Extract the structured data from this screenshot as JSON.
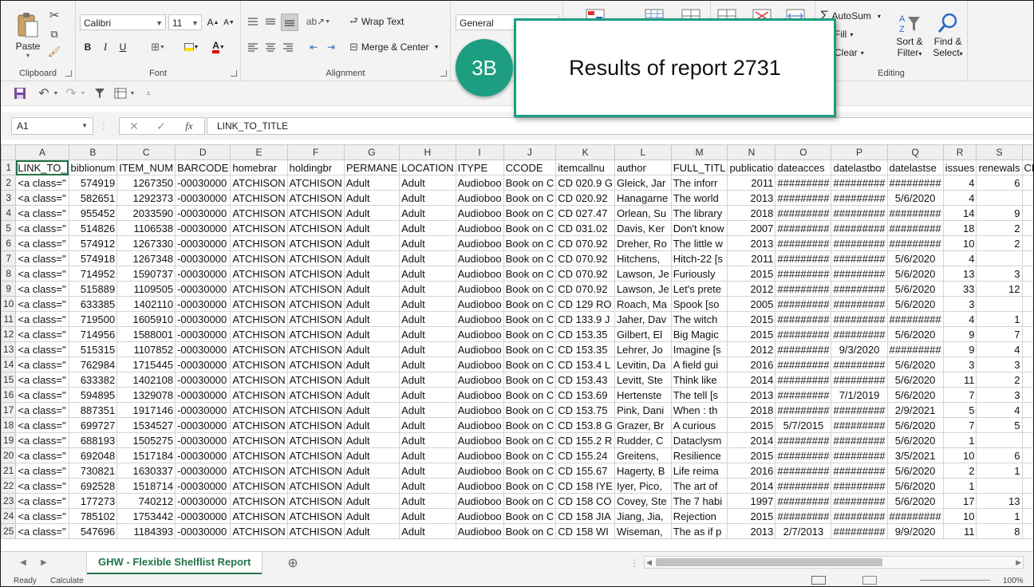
{
  "ribbon": {
    "clipboard": {
      "label": "Clipboard",
      "paste": "Paste"
    },
    "font": {
      "label": "Font",
      "name": "Calibri",
      "size": "11",
      "bold": "B",
      "italic": "I",
      "underline": "U"
    },
    "alignment": {
      "label": "Alignment",
      "wrap_text": "Wrap Text",
      "merge_center": "Merge & Center"
    },
    "number": {
      "format": "General"
    },
    "editing": {
      "label": "Editing",
      "autosum": "AutoSum",
      "fill": "Fill",
      "clear": "Clear",
      "sort_filter_1": "Sort &",
      "sort_filter_2": "Filter",
      "find_select_1": "Find &",
      "find_select_2": "Select"
    }
  },
  "formula_bar": {
    "name_box": "A1",
    "fx": "fx",
    "formula": "LINK_TO_TITLE"
  },
  "callout": {
    "badge": "3B",
    "text": "Results of report 2731"
  },
  "grid": {
    "columns": [
      "A",
      "B",
      "C",
      "D",
      "E",
      "F",
      "G",
      "H",
      "I",
      "J",
      "K",
      "L",
      "M",
      "N",
      "O",
      "P",
      "Q",
      "R",
      "S",
      "T"
    ],
    "rows": [
      [
        "LINK_TO_",
        "biblionum",
        "ITEM_NUM",
        "BARCODE",
        "homebrar",
        "holdingbr",
        "PERMANE",
        "LOCATION",
        "ITYPE",
        "CCODE",
        "itemcallnu",
        "author",
        "FULL_TITL",
        "publicatio",
        "dateacces",
        "datelastbo",
        "datelastse",
        "issues",
        "renewals",
        "CHEC"
      ],
      [
        "<a class=\"",
        "574919",
        "1267350",
        "-00030000",
        "ATCHISON",
        "ATCHISON",
        "Adult",
        "Adult",
        "Audioboo",
        "Book on C",
        "CD 020.9 G",
        "Gleick, Jar",
        "The inforr",
        "2011",
        "#########",
        "#########",
        "#########",
        "4",
        "6",
        ""
      ],
      [
        "<a class=\"",
        "582651",
        "1292373",
        "-00030000",
        "ATCHISON",
        "ATCHISON",
        "Adult",
        "Adult",
        "Audioboo",
        "Book on C",
        "CD 020.92",
        "Hanagarne",
        "The world",
        "2013",
        "#########",
        "#########",
        "5/6/2020",
        "4",
        "",
        ""
      ],
      [
        "<a class=\"",
        "955452",
        "2033590",
        "-00030000",
        "ATCHISON",
        "ATCHISON",
        "Adult",
        "Adult",
        "Audioboo",
        "Book on C",
        "CD 027.47",
        "Orlean, Su",
        "The library",
        "2018",
        "#########",
        "#########",
        "#########",
        "14",
        "9",
        ""
      ],
      [
        "<a class=\"",
        "514826",
        "1106538",
        "-00030000",
        "ATCHISON",
        "ATCHISON",
        "Adult",
        "Adult",
        "Audioboo",
        "Book on C",
        "CD 031.02",
        "Davis, Ker",
        "Don't know",
        "2007",
        "#########",
        "#########",
        "#########",
        "18",
        "2",
        ""
      ],
      [
        "<a class=\"",
        "574912",
        "1267330",
        "-00030000",
        "ATCHISON",
        "ATCHISON",
        "Adult",
        "Adult",
        "Audioboo",
        "Book on C",
        "CD 070.92",
        "Dreher, Ro",
        "The little w",
        "2013",
        "#########",
        "#########",
        "#########",
        "10",
        "2",
        ""
      ],
      [
        "<a class=\"",
        "574918",
        "1267348",
        "-00030000",
        "ATCHISON",
        "ATCHISON",
        "Adult",
        "Adult",
        "Audioboo",
        "Book on C",
        "CD 070.92",
        "Hitchens,",
        "Hitch-22 [s",
        "2011",
        "#########",
        "#########",
        "5/6/2020",
        "4",
        "",
        ""
      ],
      [
        "<a class=\"",
        "714952",
        "1590737",
        "-00030000",
        "ATCHISON",
        "ATCHISON",
        "Adult",
        "Adult",
        "Audioboo",
        "Book on C",
        "CD 070.92",
        "Lawson, Je",
        "Furiously",
        "2015",
        "#########",
        "#########",
        "5/6/2020",
        "13",
        "3",
        ""
      ],
      [
        "<a class=\"",
        "515889",
        "1109505",
        "-00030000",
        "ATCHISON",
        "ATCHISON",
        "Adult",
        "Adult",
        "Audioboo",
        "Book on C",
        "CD 070.92",
        "Lawson, Je",
        "Let's prete",
        "2012",
        "#########",
        "#########",
        "5/6/2020",
        "33",
        "12",
        ""
      ],
      [
        "<a class=\"",
        "633385",
        "1402110",
        "-00030000",
        "ATCHISON",
        "ATCHISON",
        "Adult",
        "Adult",
        "Audioboo",
        "Book on C",
        "CD 129 RO",
        "Roach, Ma",
        "Spook [so",
        "2005",
        "#########",
        "#########",
        "5/6/2020",
        "3",
        "",
        ""
      ],
      [
        "<a class=\"",
        "719500",
        "1605910",
        "-00030000",
        "ATCHISON",
        "ATCHISON",
        "Adult",
        "Adult",
        "Audioboo",
        "Book on C",
        "CD 133.9 J",
        "Jaher, Dav",
        "The witch",
        "2015",
        "#########",
        "#########",
        "#########",
        "4",
        "1",
        ""
      ],
      [
        "<a class=\"",
        "714956",
        "1588001",
        "-00030000",
        "ATCHISON",
        "ATCHISON",
        "Adult",
        "Adult",
        "Audioboo",
        "Book on C",
        "CD 153.35",
        "Gilbert, El",
        "Big Magic",
        "2015",
        "#########",
        "#########",
        "5/6/2020",
        "9",
        "7",
        ""
      ],
      [
        "<a class=\"",
        "515315",
        "1107852",
        "-00030000",
        "ATCHISON",
        "ATCHISON",
        "Adult",
        "Adult",
        "Audioboo",
        "Book on C",
        "CD 153.35",
        "Lehrer, Jo",
        "Imagine [s",
        "2012",
        "#########",
        "9/3/2020",
        "#########",
        "9",
        "4",
        ""
      ],
      [
        "<a class=\"",
        "762984",
        "1715445",
        "-00030000",
        "ATCHISON",
        "ATCHISON",
        "Adult",
        "Adult",
        "Audioboo",
        "Book on C",
        "CD 153.4 L",
        "Levitin, Da",
        "A field gui",
        "2016",
        "#########",
        "#########",
        "5/6/2020",
        "3",
        "3",
        ""
      ],
      [
        "<a class=\"",
        "633382",
        "1402108",
        "-00030000",
        "ATCHISON",
        "ATCHISON",
        "Adult",
        "Adult",
        "Audioboo",
        "Book on C",
        "CD 153.43",
        "Levitt, Ste",
        "Think like",
        "2014",
        "#########",
        "#########",
        "5/6/2020",
        "11",
        "2",
        ""
      ],
      [
        "<a class=\"",
        "594895",
        "1329078",
        "-00030000",
        "ATCHISON",
        "ATCHISON",
        "Adult",
        "Adult",
        "Audioboo",
        "Book on C",
        "CD 153.69",
        "Hertenste",
        "The tell [s",
        "2013",
        "#########",
        "7/1/2019",
        "5/6/2020",
        "7",
        "3",
        ""
      ],
      [
        "<a class=\"",
        "887351",
        "1917146",
        "-00030000",
        "ATCHISON",
        "ATCHISON",
        "Adult",
        "Adult",
        "Audioboo",
        "Book on C",
        "CD 153.75",
        "Pink, Dani",
        "When : th",
        "2018",
        "#########",
        "#########",
        "2/9/2021",
        "5",
        "4",
        ""
      ],
      [
        "<a class=\"",
        "699727",
        "1534527",
        "-00030000",
        "ATCHISON",
        "ATCHISON",
        "Adult",
        "Adult",
        "Audioboo",
        "Book on C",
        "CD 153.8 G",
        "Grazer, Br",
        "A curious",
        "2015",
        "5/7/2015",
        "#########",
        "5/6/2020",
        "7",
        "5",
        ""
      ],
      [
        "<a class=\"",
        "688193",
        "1505275",
        "-00030000",
        "ATCHISON",
        "ATCHISON",
        "Adult",
        "Adult",
        "Audioboo",
        "Book on C",
        "CD 155.2 R",
        "Rudder, C",
        "Dataclysm",
        "2014",
        "#########",
        "#########",
        "5/6/2020",
        "1",
        "",
        ""
      ],
      [
        "<a class=\"",
        "692048",
        "1517184",
        "-00030000",
        "ATCHISON",
        "ATCHISON",
        "Adult",
        "Adult",
        "Audioboo",
        "Book on C",
        "CD 155.24",
        "Greitens,",
        "Resilience",
        "2015",
        "#########",
        "#########",
        "3/5/2021",
        "10",
        "6",
        ""
      ],
      [
        "<a class=\"",
        "730821",
        "1630337",
        "-00030000",
        "ATCHISON",
        "ATCHISON",
        "Adult",
        "Adult",
        "Audioboo",
        "Book on C",
        "CD 155.67",
        "Hagerty, B",
        "Life reima",
        "2016",
        "#########",
        "#########",
        "5/6/2020",
        "2",
        "1",
        ""
      ],
      [
        "<a class=\"",
        "692528",
        "1518714",
        "-00030000",
        "ATCHISON",
        "ATCHISON",
        "Adult",
        "Adult",
        "Audioboo",
        "Book on C",
        "CD 158  IYE",
        "Iyer, Pico,",
        "The art of",
        "2014",
        "#########",
        "#########",
        "5/6/2020",
        "1",
        "",
        ""
      ],
      [
        "<a class=\"",
        "177273",
        "740212",
        "-00030000",
        "ATCHISON",
        "ATCHISON",
        "Adult",
        "Adult",
        "Audioboo",
        "Book on C",
        "CD 158 CO",
        "Covey, Ste",
        "The 7 habi",
        "1997",
        "#########",
        "#########",
        "5/6/2020",
        "17",
        "13",
        ""
      ],
      [
        "<a class=\"",
        "785102",
        "1753442",
        "-00030000",
        "ATCHISON",
        "ATCHISON",
        "Adult",
        "Adult",
        "Audioboo",
        "Book on C",
        "CD 158 JIA",
        "Jiang, Jia,",
        "Rejection",
        "2015",
        "#########",
        "#########",
        "#########",
        "10",
        "1",
        ""
      ],
      [
        "<a class=\"",
        "547696",
        "1184393",
        "-00030000",
        "ATCHISON",
        "ATCHISON",
        "Adult",
        "Adult",
        "Audioboo",
        "Book on C",
        "CD 158 WI",
        "Wiseman,",
        "The as if p",
        "2013",
        "2/7/2013",
        "#########",
        "9/9/2020",
        "11",
        "8",
        ""
      ]
    ]
  },
  "sheet_tab": "GHW - Flexible Shelflist Report",
  "status": {
    "ready": "Ready",
    "calculate": "Calculate",
    "zoom": "100%"
  },
  "colors": {
    "accent": "#217346",
    "callout": "#1d9e80"
  }
}
